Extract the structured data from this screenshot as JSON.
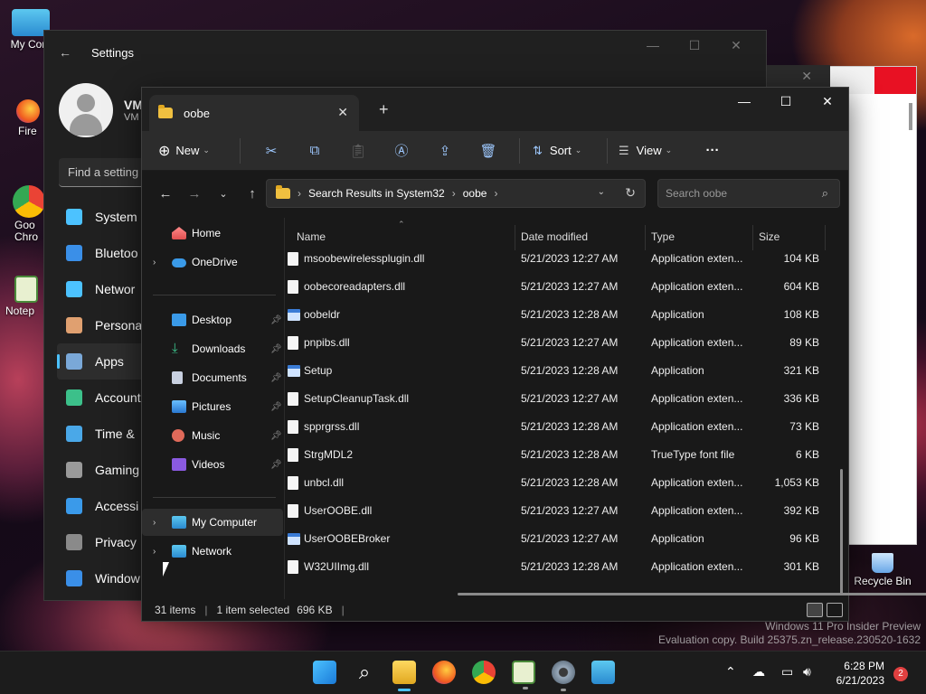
{
  "desktop": {
    "icons": [
      {
        "label": "My Com"
      },
      {
        "label": "Fire"
      },
      {
        "label": "Goo\nChro"
      },
      {
        "label": "Notep"
      },
      {
        "label": "Recycle Bin"
      }
    ]
  },
  "settings": {
    "title": "Settings",
    "user_name": "VM",
    "user_sub": "VM",
    "search_placeholder": "Find a setting",
    "nav": [
      {
        "label": "System",
        "icon": "system-icon",
        "color": "#4cc2ff"
      },
      {
        "label": "Bluetoo",
        "icon": "bluetooth-icon",
        "color": "#3a8fe8"
      },
      {
        "label": "Networ",
        "icon": "wifi-icon",
        "color": "#4cc2ff"
      },
      {
        "label": "Persona",
        "icon": "brush-icon",
        "color": "#e0a070"
      },
      {
        "label": "Apps",
        "icon": "apps-icon",
        "color": "#7aa8d8"
      },
      {
        "label": "Account",
        "icon": "account-icon",
        "color": "#3cc08a"
      },
      {
        "label": "Time &",
        "icon": "clock-icon",
        "color": "#4aa8e8"
      },
      {
        "label": "Gaming",
        "icon": "gamepad-icon",
        "color": "#9a9a9a"
      },
      {
        "label": "Accessi",
        "icon": "accessibility-icon",
        "color": "#3a9aea"
      },
      {
        "label": "Privacy",
        "icon": "shield-icon",
        "color": "#8a8a8a"
      },
      {
        "label": "Window",
        "icon": "update-icon",
        "color": "#3a8fe8"
      }
    ]
  },
  "explorer": {
    "tab_title": "oobe",
    "commands": {
      "new": "New",
      "sort": "Sort",
      "view": "View"
    },
    "breadcrumb": [
      "Search Results in System32",
      "oobe"
    ],
    "search_placeholder": "Search oobe",
    "sidebar": {
      "home": "Home",
      "onedrive": "OneDrive",
      "desktop": "Desktop",
      "downloads": "Downloads",
      "documents": "Documents",
      "pictures": "Pictures",
      "music": "Music",
      "videos": "Videos",
      "my_computer": "My Computer",
      "network": "Network"
    },
    "columns": {
      "name": "Name",
      "date": "Date modified",
      "type": "Type",
      "size": "Size"
    },
    "files": [
      {
        "name": "msoobewirelessplugin.dll",
        "date": "5/21/2023 12:27 AM",
        "type": "Application exten...",
        "size": "104 KB",
        "kind": "dll"
      },
      {
        "name": "oobecoreadapters.dll",
        "date": "5/21/2023 12:27 AM",
        "type": "Application exten...",
        "size": "604 KB",
        "kind": "dll"
      },
      {
        "name": "oobeldr",
        "date": "5/21/2023 12:28 AM",
        "type": "Application",
        "size": "108 KB",
        "kind": "app"
      },
      {
        "name": "pnpibs.dll",
        "date": "5/21/2023 12:27 AM",
        "type": "Application exten...",
        "size": "89 KB",
        "kind": "dll"
      },
      {
        "name": "Setup",
        "date": "5/21/2023 12:28 AM",
        "type": "Application",
        "size": "321 KB",
        "kind": "setup"
      },
      {
        "name": "SetupCleanupTask.dll",
        "date": "5/21/2023 12:27 AM",
        "type": "Application exten...",
        "size": "336 KB",
        "kind": "dll"
      },
      {
        "name": "spprgrss.dll",
        "date": "5/21/2023 12:28 AM",
        "type": "Application exten...",
        "size": "73 KB",
        "kind": "dll"
      },
      {
        "name": "StrgMDL2",
        "date": "5/21/2023 12:28 AM",
        "type": "TrueType font file",
        "size": "6 KB",
        "kind": "font"
      },
      {
        "name": "unbcl.dll",
        "date": "5/21/2023 12:28 AM",
        "type": "Application exten...",
        "size": "1,053 KB",
        "kind": "dll"
      },
      {
        "name": "UserOOBE.dll",
        "date": "5/21/2023 12:27 AM",
        "type": "Application exten...",
        "size": "392 KB",
        "kind": "dll"
      },
      {
        "name": "UserOOBEBroker",
        "date": "5/21/2023 12:27 AM",
        "type": "Application",
        "size": "96 KB",
        "kind": "app"
      },
      {
        "name": "W32UIImg.dll",
        "date": "5/21/2023 12:28 AM",
        "type": "Application exten...",
        "size": "301 KB",
        "kind": "dll"
      }
    ],
    "status": {
      "items": "31 items",
      "selected": "1 item selected",
      "selected_size": "696 KB"
    }
  },
  "watermark": {
    "line1": "Windows 11 Pro Insider Preview",
    "line2": "Evaluation copy. Build 25375.zn_release.230520-1632"
  },
  "taskbar": {
    "time": "6:28 PM",
    "date": "6/21/2023",
    "notification_count": "2"
  }
}
